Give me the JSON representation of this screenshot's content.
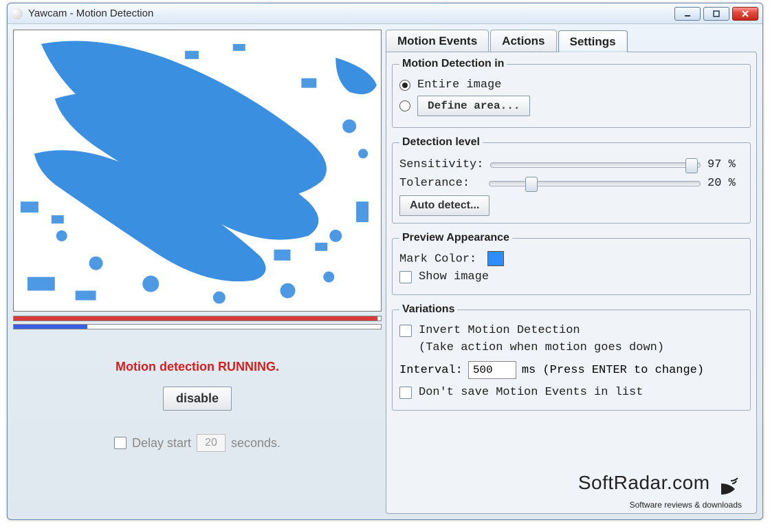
{
  "window": {
    "title": "Yawcam - Motion Detection"
  },
  "tabs": {
    "motion_events": "Motion Events",
    "actions": "Actions",
    "settings": "Settings"
  },
  "detection_in": {
    "legend": "Motion Detection in",
    "entire": "Entire image",
    "define_btn": "Define area..."
  },
  "level": {
    "legend": "Detection level",
    "sens_label": "Sensitivity:",
    "sens_value": "97 %",
    "sens_pct": 96,
    "tol_label": "Tolerance:",
    "tol_value": "20 %",
    "tol_pct": 20,
    "auto_btn": "Auto detect..."
  },
  "preview_app": {
    "legend": "Preview Appearance",
    "mark_label": "Mark Color:",
    "mark_color": "#2d8cff",
    "show_label": "Show image"
  },
  "variations": {
    "legend": "Variations",
    "invert_label": "Invert Motion Detection",
    "invert_sub": "(Take action when motion goes down)",
    "interval_label": "Interval:",
    "interval_value": "500",
    "interval_suffix": "ms (Press ENTER to change)",
    "dont_save_label": "Don't save Motion Events in list"
  },
  "status": {
    "running": "Motion detection RUNNING.",
    "disable_btn": "disable",
    "delay_prefix": "Delay start",
    "delay_value": "20",
    "delay_suffix": "seconds."
  },
  "bars": {
    "red_pct": 99,
    "blue_pct": 20
  },
  "watermark": {
    "brand": "SoftRadar.com",
    "tag": "Software reviews & downloads"
  }
}
